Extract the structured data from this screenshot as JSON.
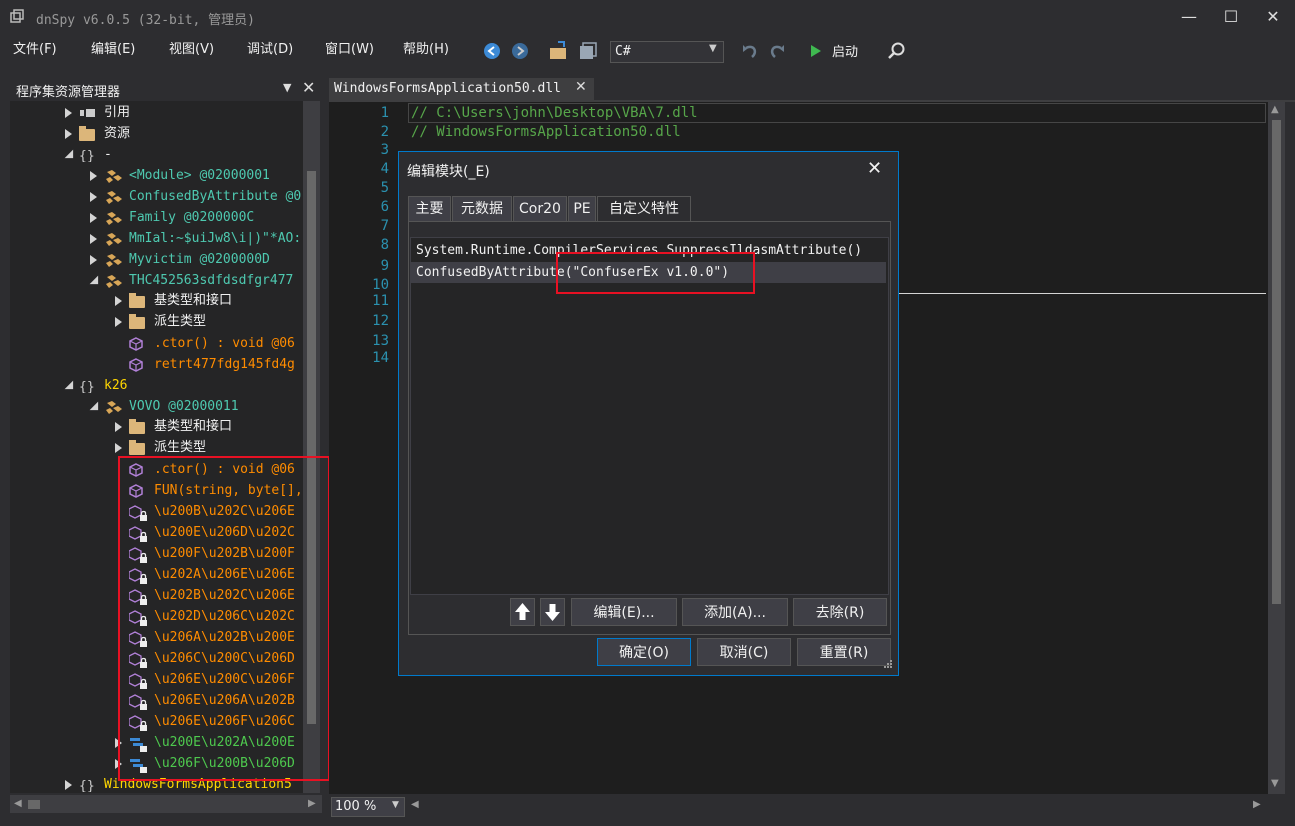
{
  "app": {
    "title": "dnSpy v6.0.5 (32-bit, 管理员)"
  },
  "menu": {
    "items": [
      "文件(F)",
      "编辑(E)",
      "视图(V)",
      "调试(D)",
      "窗口(W)",
      "帮助(H)"
    ]
  },
  "toolbar": {
    "language": "C#",
    "start_label": "启动"
  },
  "explorer": {
    "title": "程序集资源管理器",
    "rows": [
      {
        "label": "引用",
        "color": "c-white"
      },
      {
        "label": "资源",
        "color": "c-white"
      },
      {
        "label": "-",
        "color": "c-white"
      },
      {
        "label": "<Module> @02000001",
        "color": "c-teal"
      },
      {
        "label": "ConfusedByAttribute @0",
        "color": "c-teal"
      },
      {
        "label": "Family @0200000C",
        "color": "c-teal"
      },
      {
        "label": "MmIal:~$uiJw8\\i|)\"*AO:",
        "color": "c-teal"
      },
      {
        "label": "Myvictim @0200000D",
        "color": "c-teal"
      },
      {
        "label": "THC452563sdfdsdfgr477",
        "color": "c-teal"
      },
      {
        "label": "基类型和接口",
        "color": "c-white"
      },
      {
        "label": "派生类型",
        "color": "c-white"
      },
      {
        "label": ".ctor() : void @06",
        "color": "c-orange"
      },
      {
        "label": "retrt477fdg145fd4g",
        "color": "c-orange"
      },
      {
        "label": "k26",
        "color": "c-yellow"
      },
      {
        "label": "VOVO @02000011",
        "color": "c-teal"
      },
      {
        "label": "基类型和接口",
        "color": "c-white"
      },
      {
        "label": "派生类型",
        "color": "c-white"
      },
      {
        "label": ".ctor() : void @06",
        "color": "c-orange"
      },
      {
        "label": "FUN(string, byte[],",
        "color": "c-orange"
      },
      {
        "label": "\\u200B\\u202C\\u206E",
        "color": "c-orange"
      },
      {
        "label": "\\u200E\\u206D\\u202C",
        "color": "c-orange"
      },
      {
        "label": "\\u200F\\u202B\\u200F",
        "color": "c-orange"
      },
      {
        "label": "\\u202A\\u206E\\u206E",
        "color": "c-orange"
      },
      {
        "label": "\\u202B\\u202C\\u206E",
        "color": "c-orange"
      },
      {
        "label": "\\u202D\\u206C\\u202C",
        "color": "c-orange"
      },
      {
        "label": "\\u206A\\u202B\\u200E",
        "color": "c-orange"
      },
      {
        "label": "\\u206C\\u200C\\u206D",
        "color": "c-orange"
      },
      {
        "label": "\\u206E\\u200C\\u206F",
        "color": "c-orange"
      },
      {
        "label": "\\u206E\\u206A\\u202B",
        "color": "c-orange"
      },
      {
        "label": "\\u206E\\u206F\\u206C",
        "color": "c-orange"
      },
      {
        "label": "\\u200E\\u202A\\u200E",
        "color": "c-green"
      },
      {
        "label": "\\u206F\\u200B\\u206D",
        "color": "c-green"
      },
      {
        "label": "WindowsFormsApplication5",
        "color": "c-yellow"
      }
    ]
  },
  "editor": {
    "tab_title": "WindowsFormsApplication50.dll",
    "line_numbers": [
      "1",
      "2",
      "3",
      "4",
      "5",
      "6",
      "7",
      "8",
      "9",
      "10",
      "11",
      "12",
      "13",
      "14"
    ],
    "code_lines": [
      "// C:\\Users\\john\\Desktop\\VBA\\7.dll",
      "// WindowsFormsApplication50.dll"
    ],
    "zoom": "100 %"
  },
  "dialog": {
    "title": "编辑模块(_E)",
    "tabs": [
      "主要",
      "元数据",
      "Cor20",
      "PE",
      "自定义特性"
    ],
    "attributes": [
      "System.Runtime.CompilerServices.SuppressIldasmAttribute()",
      "ConfusedByAttribute(\"ConfuserEx v1.0.0\")"
    ],
    "edit_btn": "编辑(E)...",
    "add_btn": "添加(A)...",
    "remove_btn": "去除(R)",
    "ok_btn": "确定(O)",
    "cancel_btn": "取消(C)",
    "reset_btn": "重置(R)"
  },
  "colors": {
    "accent": "#007acc",
    "highlight_box": "#e81123",
    "background": "#2d2d30",
    "editor_bg": "#1e1e1e"
  }
}
